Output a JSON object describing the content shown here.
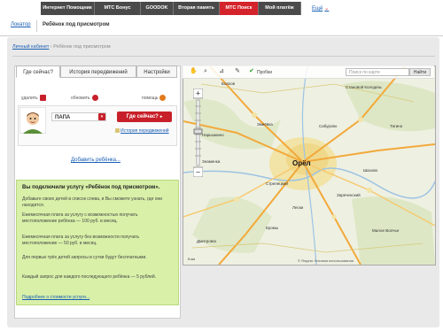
{
  "topnav": {
    "tabs": [
      {
        "label": "Интернет Помощник",
        "active": false
      },
      {
        "label": "МТС Бонус",
        "active": false
      },
      {
        "label": "GOODOK",
        "active": false
      },
      {
        "label": "Вторая память",
        "active": false
      },
      {
        "label": "МТС Поиск",
        "active": true
      },
      {
        "label": "Мой платёж",
        "active": false
      }
    ],
    "more_label": "Ещё",
    "more_icon": "chevron-down-icon"
  },
  "subnav": {
    "items": [
      "Локатор",
      "Ребёнок под присмотром"
    ],
    "active_index": 1
  },
  "breadcrumb": {
    "root": "Личный кабинет",
    "current": "Ребёнок под присмотром"
  },
  "left_tabs": [
    "Где сейчас?",
    "История передвижений",
    "Настройки"
  ],
  "actions": {
    "delete": "удалить",
    "refresh": "обновить",
    "help": "помощь"
  },
  "child": {
    "name": "ПАПА",
    "where_button": "Где сейчас?",
    "history_link": "История передвижений"
  },
  "add_child": "Добавить ребёнка...",
  "info": {
    "title": "Вы подключили услугу «Ребёнок под присмотром».",
    "p1": "Добавьте своих детей в список слева, и Вы сможете узнать, где они находятся.",
    "p2": "Ежемесячная плата за услугу с возможностью получать местоположение ребёнка — 100 руб. в месяц.",
    "p3": "Ежемесячная плата за услугу без возможности получать местоположение — 50 руб. в месяц.",
    "p4": "Для первых трёх детей запросы в сутки будут бесплатными.",
    "p5": "Каждый запрос для каждого последующего ребёнка — 5 рублей.",
    "tariff_link": "Подробнее о стоимости услуги..."
  },
  "map": {
    "search_placeholder": "Поиск по карте",
    "search_button": "Найти",
    "tools": [
      "hand-icon",
      "zoom-area-icon",
      "ruler-icon",
      "checkbox-icon"
    ],
    "layer_label": "Пробки",
    "city": "Орёл",
    "places": [
      "Болхов",
      "Становой Колодезь",
      "Змиёвка",
      "Кромы",
      "Нарышкино",
      "Сабурово",
      "Знаменка",
      "Шахово",
      "Тагино",
      "Дмитровск",
      "Зареченский",
      "Лески",
      "Стрелецкий",
      "Малое Волчье"
    ],
    "copyright": "© Яндекс  Условия использования",
    "scale": "5 км"
  },
  "colors": {
    "brand_red": "#c8202a",
    "nav_dark": "#4a4a4a",
    "info_bg": "#d8f0a8",
    "link": "#1a5fb4"
  }
}
